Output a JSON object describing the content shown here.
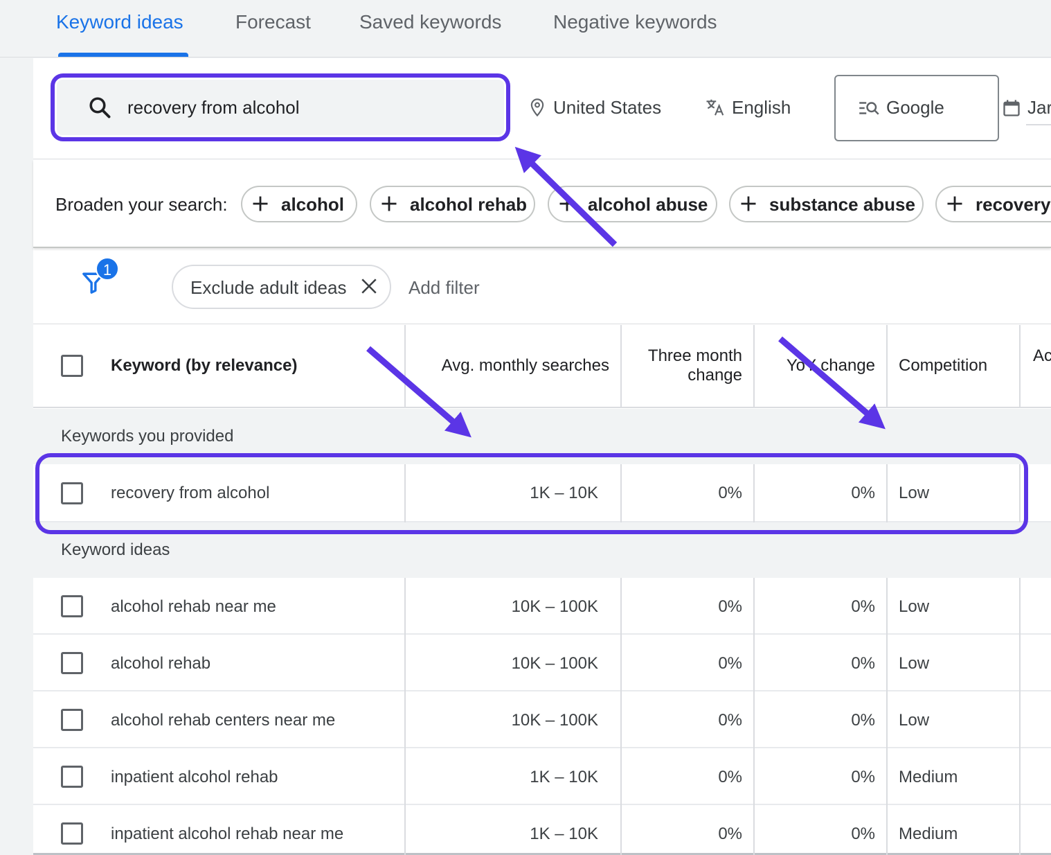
{
  "tabs": [
    {
      "label": "Keyword ideas",
      "active": true
    },
    {
      "label": "Forecast",
      "active": false
    },
    {
      "label": "Saved keywords",
      "active": false
    },
    {
      "label": "Negative keywords",
      "active": false
    }
  ],
  "search": {
    "value": "recovery from alcohol"
  },
  "targeting": {
    "location": "United States",
    "language": "English",
    "network": "Google",
    "date": "Jar"
  },
  "broaden": {
    "label": "Broaden your search:",
    "chips": [
      "alcohol",
      "alcohol rehab",
      "alcohol abuse",
      "substance abuse",
      "recovery f"
    ]
  },
  "filters": {
    "count": "1",
    "chip": "Exclude adult ideas",
    "add": "Add filter"
  },
  "table": {
    "columns": {
      "keyword": "Keyword (by relevance)",
      "searches": "Avg. monthly searches",
      "three_month_1": "Three month",
      "three_month_2": "change",
      "yoy": "YoY change",
      "competition": "Competition",
      "next": "Ac"
    },
    "groups": {
      "provided": "Keywords you provided",
      "ideas": "Keyword ideas"
    },
    "provided_rows": [
      {
        "keyword": "recovery from alcohol",
        "searches": "1K – 10K",
        "three_month": "0%",
        "yoy": "0%",
        "competition": "Low"
      }
    ],
    "idea_rows": [
      {
        "keyword": "alcohol rehab near me",
        "searches": "10K – 100K",
        "three_month": "0%",
        "yoy": "0%",
        "competition": "Low"
      },
      {
        "keyword": "alcohol rehab",
        "searches": "10K – 100K",
        "three_month": "0%",
        "yoy": "0%",
        "competition": "Low"
      },
      {
        "keyword": "alcohol rehab centers near me",
        "searches": "10K – 100K",
        "three_month": "0%",
        "yoy": "0%",
        "competition": "Low"
      },
      {
        "keyword": "inpatient alcohol rehab",
        "searches": "1K – 10K",
        "three_month": "0%",
        "yoy": "0%",
        "competition": "Medium"
      },
      {
        "keyword": "inpatient alcohol rehab near me",
        "searches": "1K – 10K",
        "three_month": "0%",
        "yoy": "0%",
        "competition": "Medium"
      }
    ]
  },
  "colors": {
    "accent": "#1a73e8",
    "annotation": "#5b35e6"
  }
}
